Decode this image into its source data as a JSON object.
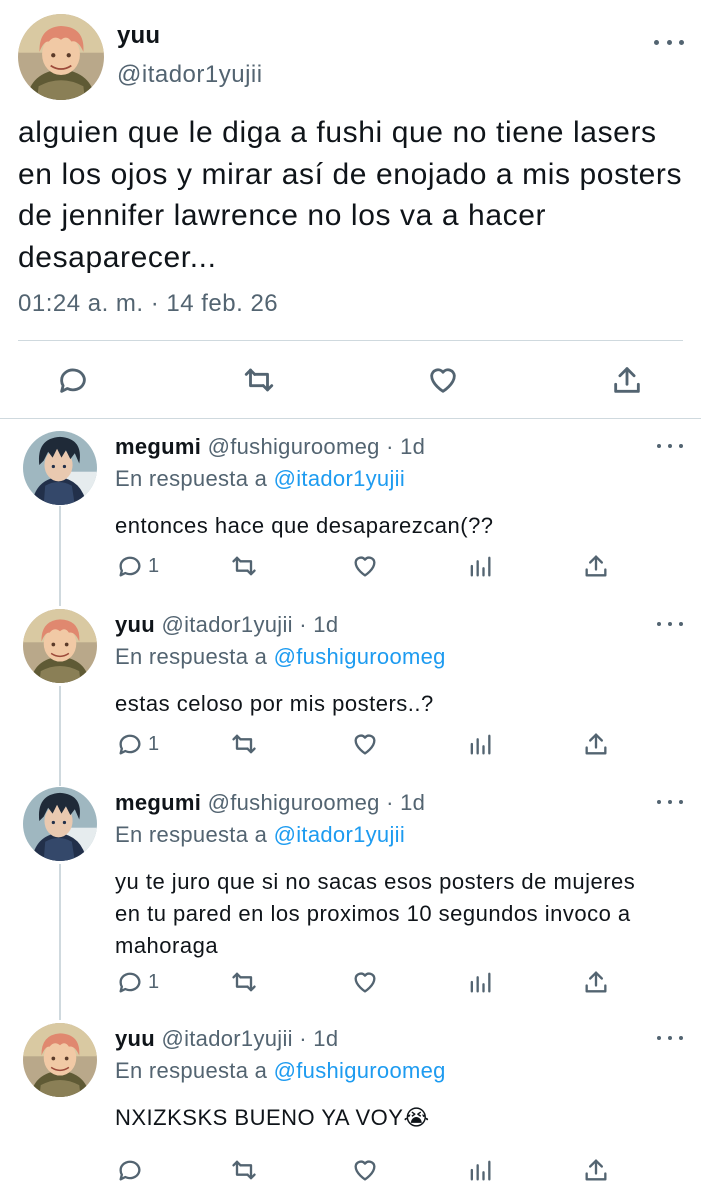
{
  "main_tweet": {
    "name": "yuu",
    "handle": "@itador1yujii",
    "text": "alguien que le diga a fushi que no tiene lasers en los ojos y mirar así de enojado a mis posters de jennifer lawrence no los va a hacer desaparecer...",
    "timestamp": "01:24 a. m. · 14 feb. 26",
    "actions": [
      "reply-icon",
      "retweet-icon",
      "like-icon",
      "share-icon"
    ]
  },
  "replies": [
    {
      "name": "megumi",
      "handle": "@fushiguroomeg",
      "time": "· 1d",
      "reply_prefix": "En respuesta a",
      "reply_to": "@itador1yujii",
      "text": "entonces hace que desaparezcan(??",
      "reply_count": "1"
    },
    {
      "name": "yuu",
      "handle": "@itador1yujii",
      "time": "· 1d",
      "reply_prefix": "En respuesta a",
      "reply_to": "@fushiguroomeg",
      "text": "estas celoso por mis posters..?",
      "reply_count": "1"
    },
    {
      "name": "megumi",
      "handle": "@fushiguroomeg",
      "time": "· 1d",
      "reply_prefix": "En respuesta a",
      "reply_to": "@itador1yujii",
      "text": "yu te juro que si no sacas esos posters de mujeres en tu pared en los proximos 10 segundos invoco a mahoraga",
      "reply_count": "1"
    },
    {
      "name": "yuu",
      "handle": "@itador1yujii",
      "time": "· 1d",
      "reply_prefix": "En respuesta a",
      "reply_to": "@fushiguroomeg",
      "text": "NXIZKSKS BUENO YA VOY😭",
      "reply_count": ""
    }
  ],
  "colors": {
    "text": "#0f1419",
    "secondary": "#536471",
    "link": "#1d9bf0",
    "divider": "#cfd9de"
  }
}
